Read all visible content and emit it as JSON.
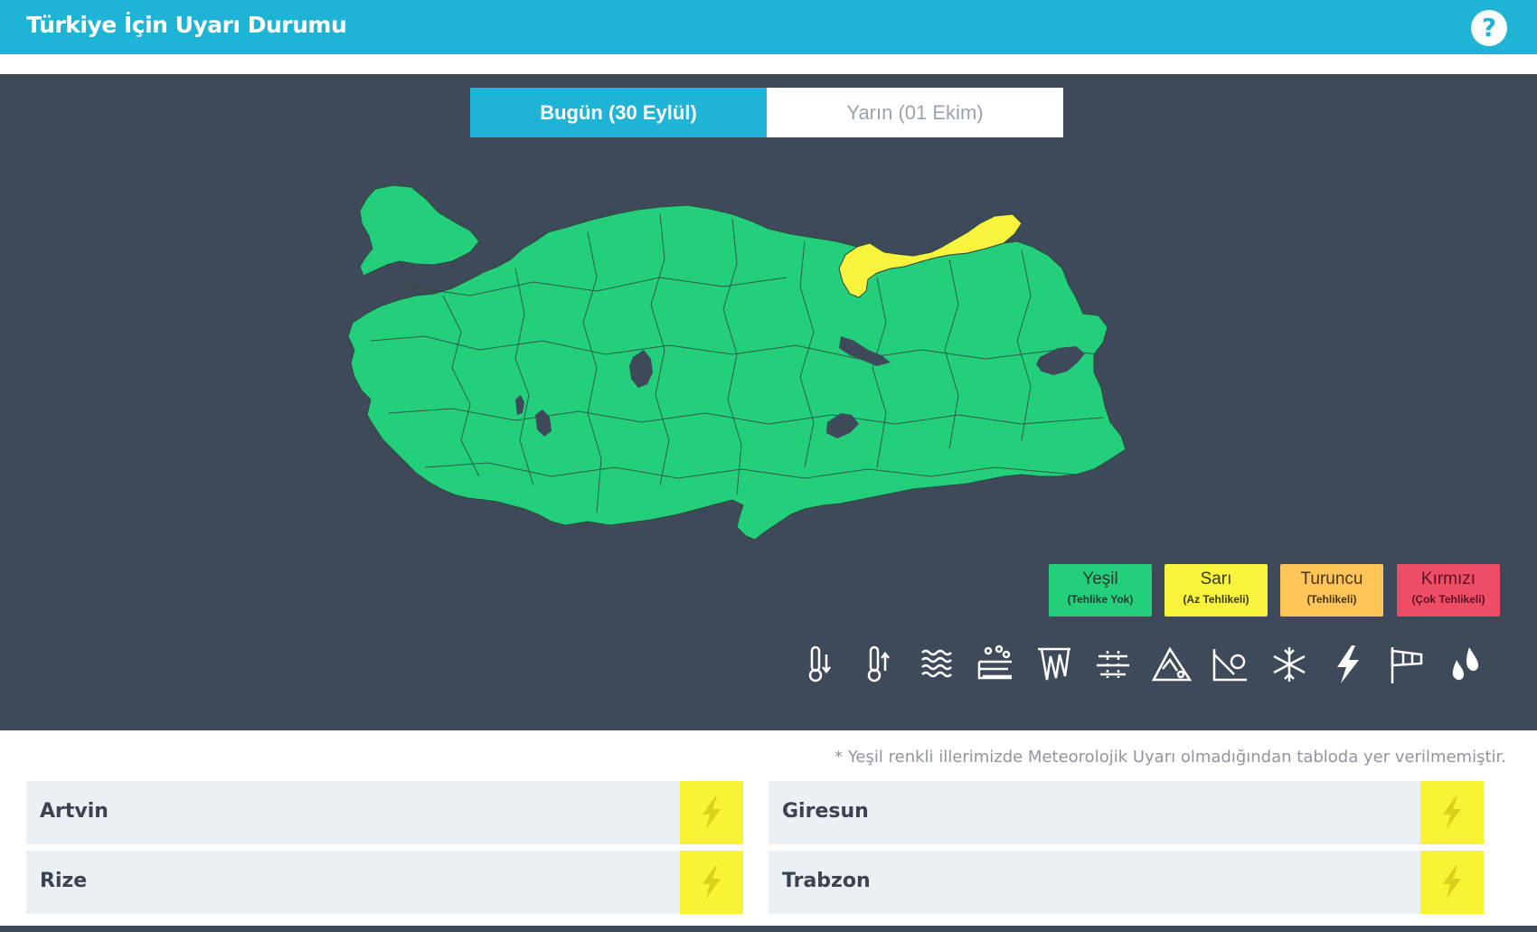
{
  "header": {
    "title": "Türkiye İçin Uyarı Durumu",
    "help_icon": "question-circle-icon",
    "help_label": "?"
  },
  "tabs": [
    {
      "label": "Bugün (30 Eylül)",
      "active": true
    },
    {
      "label": "Yarın (01 Ekim)",
      "active": false
    }
  ],
  "map": {
    "colors": {
      "green": "#23cf7a",
      "yellow": "#f8f33c",
      "background": "#3e4a59"
    },
    "yellow_region": "Kuzeydoğu Karadeniz kıyısı"
  },
  "legend": [
    {
      "name": "Yeşil",
      "sub": "(Tehlike Yok)",
      "color": "#23cf7a",
      "text_color": "#1d3b2a"
    },
    {
      "name": "Sarı",
      "sub": "(Az Tehlikeli)",
      "color": "#f8f33c",
      "text_color": "#3b3a10"
    },
    {
      "name": "Turuncu",
      "sub": "(Tehlikeli)",
      "color": "#fec659",
      "text_color": "#4a3512"
    },
    {
      "name": "Kırmızı",
      "sub": "(Çok Tehlikeli)",
      "color": "#ef4c67",
      "text_color": "#5a1220"
    }
  ],
  "weather_icons": [
    "low-temperature-icon",
    "high-temperature-icon",
    "fog-icon",
    "dust-storm-icon",
    "icing-icon",
    "snow-melt-avalanche-icon",
    "avalanche-icon",
    "landslide-icon",
    "snow-icon",
    "thunderstorm-icon",
    "wind-icon",
    "rain-icon"
  ],
  "note": "* Yeşil renkli illerimizde Meteorolojik Uyarı olmadığından tabloda yer verilmemiştir.",
  "warnings": [
    {
      "city": "Artvin",
      "icon": "lightning-icon"
    },
    {
      "city": "Giresun",
      "icon": "lightning-icon"
    },
    {
      "city": "Rize",
      "icon": "lightning-icon"
    },
    {
      "city": "Trabzon",
      "icon": "lightning-icon"
    }
  ]
}
